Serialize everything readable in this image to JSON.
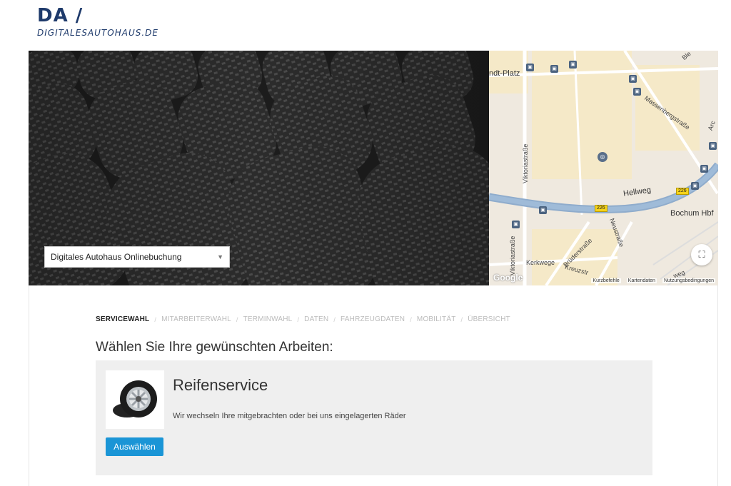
{
  "brand": {
    "logo_mark": "DA /",
    "logo_text": "DIGITALESAUTOHAUS.DE"
  },
  "hero": {
    "image": "tires-photo",
    "dealer_select": {
      "selected": "Digitales Autohaus Onlinebuchung"
    },
    "map": {
      "labels": {
        "platz": "ndt-Platz",
        "massenberg": "Massenbergstraße",
        "viktoria": "Viktoriastraße",
        "viktoria2": "Viktoriastraße",
        "hellweg": "Hellweg",
        "bochum_hbf": "Bochum Hbf",
        "bruder": "Brüderstraße",
        "neu": "Neustraße",
        "kerkwege": "Kerkwege",
        "kreuz": "Kreuzstr",
        "weg": "weg",
        "ble": "Ble",
        "arc": "Arc"
      },
      "route_shield": "226",
      "footer": {
        "shortcuts": "Kurzbefehle",
        "map_data": "Kartendaten",
        "terms": "Nutzungsbedingungen"
      },
      "google": "Google"
    }
  },
  "steps": [
    {
      "label": "SERVICEWAHL",
      "active": true
    },
    {
      "label": "MITARBEITERWAHL",
      "active": false
    },
    {
      "label": "TERMINWAHL",
      "active": false
    },
    {
      "label": "DATEN",
      "active": false
    },
    {
      "label": "FAHRZEUGDATEN",
      "active": false
    },
    {
      "label": "MOBILITÄT",
      "active": false
    },
    {
      "label": "ÜBERSICHT",
      "active": false
    }
  ],
  "step_separator": "/",
  "heading": "Wählen Sie Ihre gewünschten Arbeiten:",
  "service": {
    "title": "Reifenservice",
    "description": "Wir wechseln Ihre mitgebrachten oder bei uns eingelagerten Räder",
    "button": "Auswählen"
  },
  "colors": {
    "brand": "#1e3a6b",
    "button": "#1a95d6",
    "card_bg": "#efefef"
  }
}
